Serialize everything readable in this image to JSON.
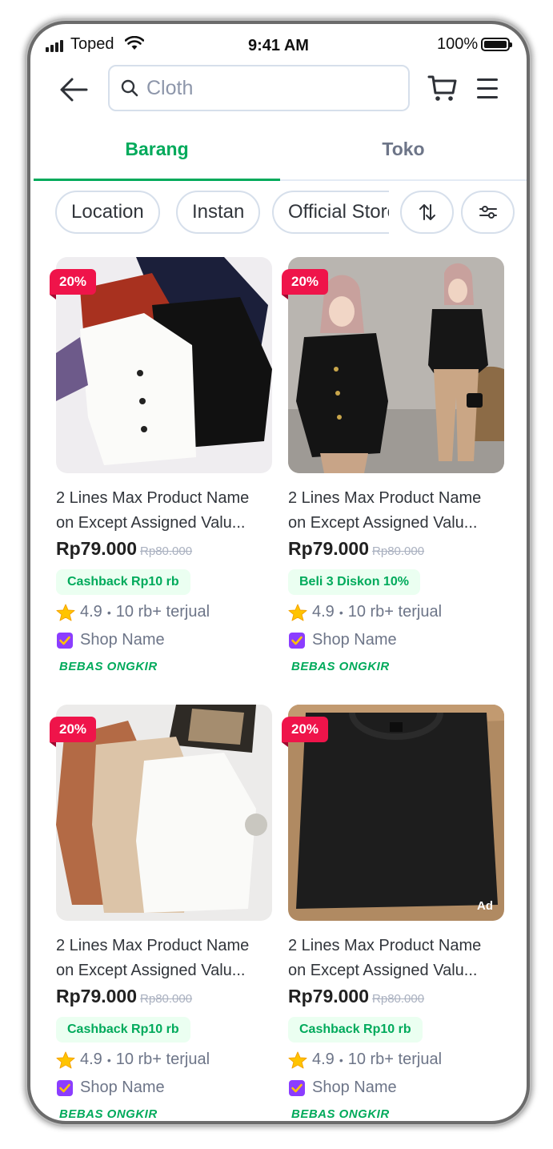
{
  "status_bar": {
    "carrier": "Toped",
    "time": "9:41 AM",
    "battery": "100%"
  },
  "header": {
    "search_placeholder": "Cloth"
  },
  "tabs": [
    {
      "label": "Barang",
      "active": true
    },
    {
      "label": "Toko",
      "active": false
    }
  ],
  "filters": [
    "Location",
    "Instan",
    "Official Store"
  ],
  "filter_icons": [
    "sort-icon",
    "filter-settings-icon"
  ],
  "colors": {
    "brand": "#00AA5B",
    "discount": "#EF144A",
    "star": "#FFC400",
    "shop_badge": "#8B3DFF"
  },
  "products": [
    {
      "discount": "20%",
      "name_line1": "2 Lines Max Product Name",
      "name_line2": "on Except Assigned Valu...",
      "price": "Rp79.000",
      "original_price": "Rp80.000",
      "promo": "Cashback Rp10 rb",
      "rating": "4.9",
      "sold": "10 rb+ terjual",
      "shop": "Shop Name",
      "shipping": "BEBAS ONGKIR",
      "ad": ""
    },
    {
      "discount": "20%",
      "name_line1": "2 Lines Max Product Name",
      "name_line2": "on Except Assigned Valu...",
      "price": "Rp79.000",
      "original_price": "Rp80.000",
      "promo": "Beli 3 Diskon 10%",
      "rating": "4.9",
      "sold": "10 rb+ terjual",
      "shop": "Shop Name",
      "shipping": "BEBAS ONGKIR",
      "ad": ""
    },
    {
      "discount": "20%",
      "name_line1": "2 Lines Max Product Name",
      "name_line2": "on Except Assigned Valu...",
      "price": "Rp79.000",
      "original_price": "Rp80.000",
      "promo": "Cashback Rp10 rb",
      "rating": "4.9",
      "sold": "10 rb+ terjual",
      "shop": "Shop Name",
      "shipping": "BEBAS ONGKIR",
      "ad": ""
    },
    {
      "discount": "20%",
      "name_line1": "2 Lines Max Product Name",
      "name_line2": "on Except Assigned Valu...",
      "price": "Rp79.000",
      "original_price": "Rp80.000",
      "promo": "Cashback Rp10 rb",
      "rating": "4.9",
      "sold": "10 rb+ terjual",
      "shop": "Shop Name",
      "shipping": "BEBAS ONGKIR",
      "ad": "Ad"
    }
  ]
}
